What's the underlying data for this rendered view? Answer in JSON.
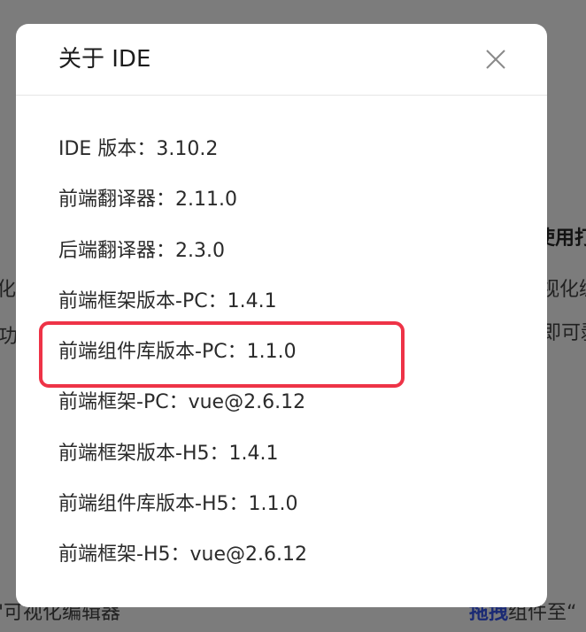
{
  "dialog": {
    "title": "关于 IDE",
    "close_icon": "close-icon",
    "rows": [
      {
        "label": "IDE 版本",
        "sep": "：",
        "value": "3.10.2"
      },
      {
        "label": "前端翻译器",
        "sep": "：",
        "value": "2.11.0"
      },
      {
        "label": "后端翻译器",
        "sep": "：",
        "value": "2.3.0"
      },
      {
        "label": "前端框架版本-PC",
        "sep": "：",
        "value": "1.4.1"
      },
      {
        "label": "前端组件库版本-PC",
        "sep": "：",
        "value": "1.1.0"
      },
      {
        "label": "前端框架-PC",
        "sep": "：",
        "value": "vue@2.6.12"
      },
      {
        "label": "前端框架版本-H5",
        "sep": "：",
        "value": "1.4.1"
      },
      {
        "label": "前端组件库版本-H5",
        "sep": "：",
        "value": "1.1.0"
      },
      {
        "label": "前端框架-H5",
        "sep": "：",
        "value": "vue@2.6.12"
      }
    ]
  },
  "background": {
    "right_heading": "使用打",
    "right_line_1": "视化编",
    "right_line_2": "即可剥",
    "left_line_1": "化乡",
    "left_line_2": "功",
    "bottom_left": "'可视化编辑器",
    "bottom_right_link": "拖拽",
    "bottom_right_text": "组件至“"
  },
  "colors": {
    "highlight": "#ee3347",
    "link": "#2f49c9"
  }
}
